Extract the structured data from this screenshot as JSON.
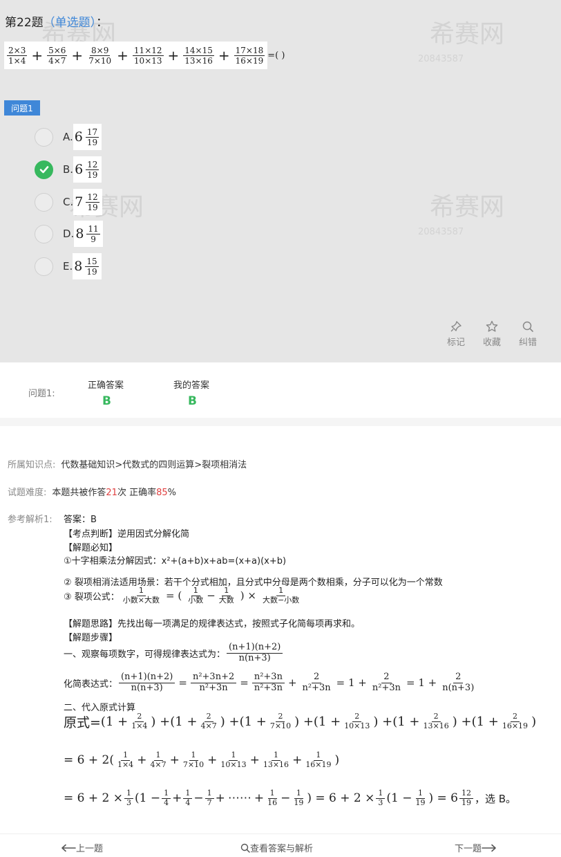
{
  "question": {
    "number": "第22题",
    "type": "（单选题）",
    "colon": "：",
    "formula": {
      "terms": [
        {
          "num": "2×3",
          "den": "1×4"
        },
        {
          "num": "5×6",
          "den": "4×7"
        },
        {
          "num": "8×9",
          "den": "7×10"
        },
        {
          "num": "11×12",
          "den": "10×13"
        },
        {
          "num": "14×15",
          "den": "13×16"
        },
        {
          "num": "17×18",
          "den": "16×19"
        }
      ],
      "plus": "+",
      "tail": "=(    )"
    },
    "tag": "问题1",
    "options": [
      {
        "label": "A.",
        "whole": "6",
        "num": "17",
        "den": "19",
        "selected": false
      },
      {
        "label": "B.",
        "whole": "6",
        "num": "12",
        "den": "19",
        "selected": true
      },
      {
        "label": "C.",
        "whole": "7",
        "num": "12",
        "den": "19",
        "selected": false
      },
      {
        "label": "D.",
        "whole": "8",
        "num": "11",
        "den": "9",
        "selected": false
      },
      {
        "label": "E.",
        "whole": "8",
        "num": "15",
        "den": "19",
        "selected": false
      }
    ]
  },
  "watermark": {
    "brand": "希赛网",
    "id": "20843587"
  },
  "tools": {
    "mark": "标记",
    "favorite": "收藏",
    "report": "纠错"
  },
  "answer": {
    "label": "问题1:",
    "correct_header": "正确答案",
    "correct_value": "B",
    "mine_header": "我的答案",
    "mine_value": "B"
  },
  "knowledge": {
    "label": "所属知识点:",
    "value": "代数基础知识>代数式的四则运算>裂项相消法"
  },
  "difficulty": {
    "label": "试题难度:",
    "prefix": "本题共被作答",
    "count": "21",
    "mid": "次 正确率",
    "rate": "85",
    "suffix": "%"
  },
  "analysis": {
    "label": "参考解析1:",
    "answer_line": "答案：B",
    "kp_title": "【考点判断】逆用因式分解化简",
    "must_title": "【解题必知】",
    "item1": "①十字相乘法分解因式：x²+(a+b)x+ab=(x+a)(x+b)",
    "item2": "② 裂项相消法适用场景：若干个分式相加，且分式中分母是两个数相乘，分子可以化为一个常数",
    "item3_prefix": "③ 裂项公式：",
    "f_one": "1",
    "f_small_times_big": "小数×大数",
    "f_small": "小数",
    "f_big": "大数",
    "f_big_minus_small": "大数−小数",
    "idea": "【解题思路】先找出每一项满足的规律表达式，按照式子化简每项再求和。",
    "steps_title": "【解题步骤】",
    "step1": "一、观察每项数字，可得规律表达式为：",
    "expr_num": "(n+1)(n+2)",
    "expr_den": "n(n+3)",
    "simplify_label": "化简表达式：",
    "s_num2": "n²+3n+2",
    "s_den2": "n²+3n",
    "s_num3": "n²+3n",
    "s_two": "2",
    "s_one": "1",
    "step2": "二、代入原式计算",
    "orig": "原式=",
    "line1_dens": [
      "1×4",
      "4×7",
      "7×10",
      "10×13",
      "13×16",
      "16×19"
    ],
    "line3_mid": "⋯⋯",
    "line3_tail_num": "12",
    "line3_tail_den": "19",
    "line3_end": "，选 B。",
    "three": "3",
    "four": "4",
    "seven": "7",
    "sixteen": "16",
    "nineteen": "19"
  },
  "nav": {
    "prev": "上一题",
    "view": "查看答案与解析",
    "next": "下一题"
  }
}
